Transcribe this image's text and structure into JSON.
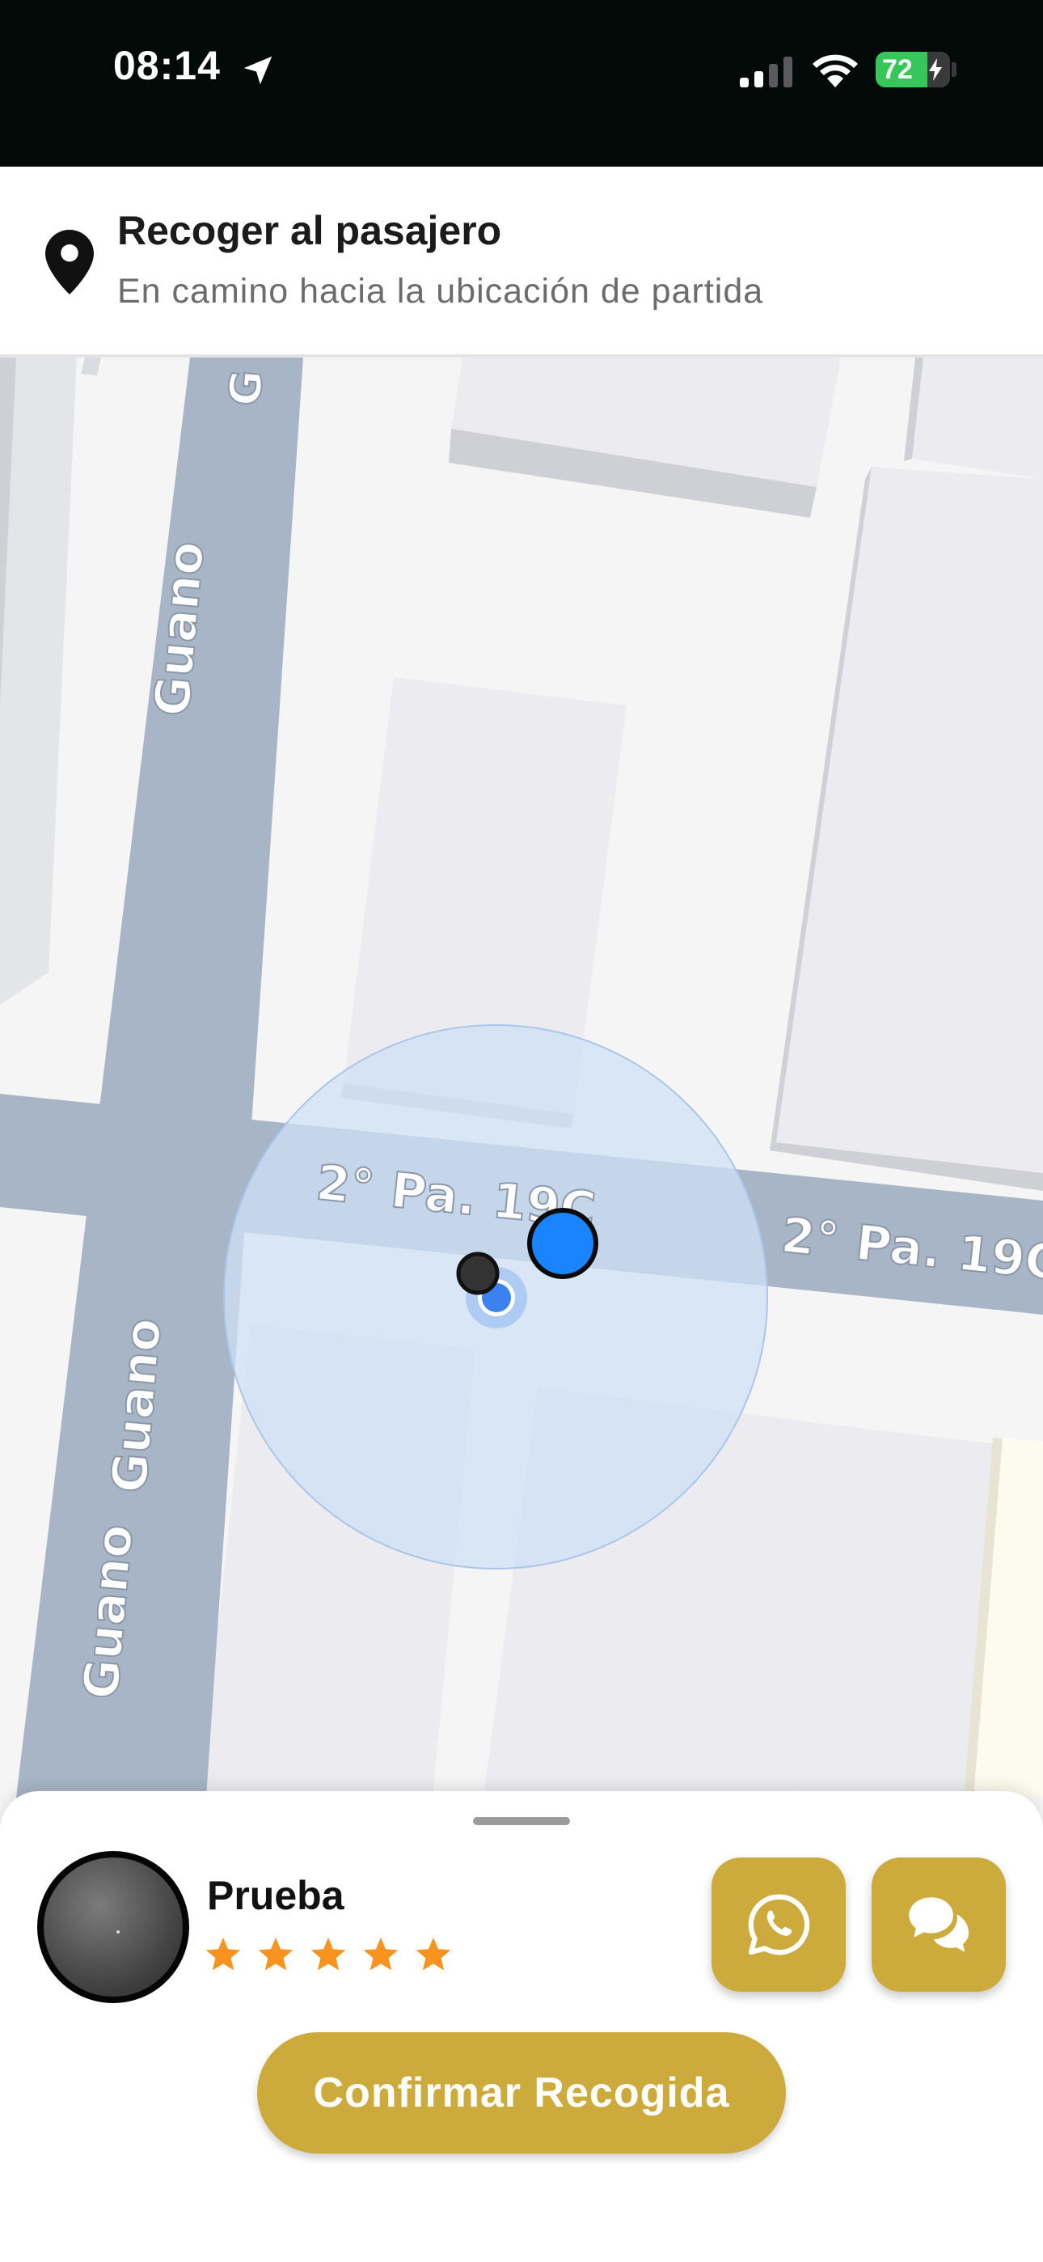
{
  "status_bar": {
    "time": "08:14",
    "battery_level": "72",
    "icons": [
      "location-arrow-icon",
      "cellular-signal-icon",
      "wifi-icon",
      "battery-charging-icon"
    ]
  },
  "header": {
    "icon": "map-pin-icon",
    "title": "Recoger al pasajero",
    "subtitle": "En camino hacia la ubicación de partida"
  },
  "map": {
    "streets": {
      "vertical_top": "G",
      "vertical_upper": "Guano",
      "vertical_lower_a": "Guano",
      "vertical_lower_b": "Guano",
      "horizontal_left": "2° Pa. 19C",
      "horizontal_right": "2° Pa. 19C"
    },
    "markers": [
      "driver-location-marker",
      "passenger-location-marker",
      "pickup-destination-marker"
    ],
    "colors": {
      "road": "#a8b5c7",
      "accuracy_circle": "#cfe0f5",
      "marker_blue": "#1a84ff"
    }
  },
  "bottom_sheet": {
    "passenger_name": "Prueba",
    "rating": 5,
    "rating_max": 5,
    "whatsapp_icon": "whatsapp-icon",
    "chat_icon": "chat-bubbles-icon",
    "confirm_label": "Confirmar Recogida",
    "colors": {
      "accent": "#ccab3c",
      "star": "#f7931e"
    }
  }
}
